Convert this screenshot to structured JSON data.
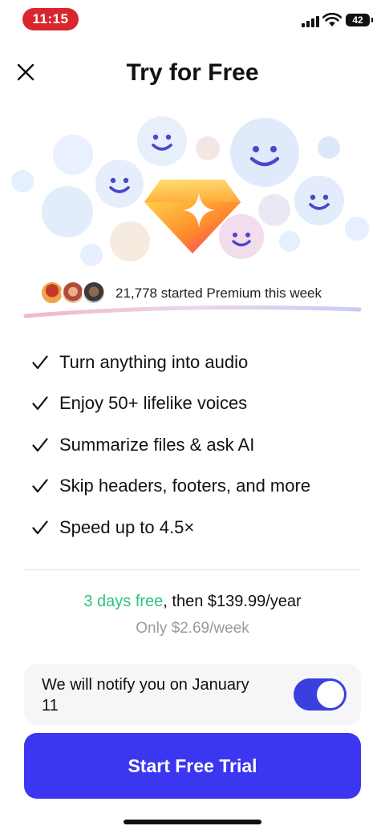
{
  "status_bar": {
    "time": "11:15",
    "battery": "42"
  },
  "header": {
    "title": "Try for Free",
    "close_icon": "close-icon"
  },
  "hero": {
    "center_icon": "diamond-sparkle-icon",
    "faces": [
      "smiley-face",
      "smiley-face",
      "smiley-face",
      "smiley-face",
      "smiley-face"
    ]
  },
  "social_proof": {
    "text": "21,778 started Premium this week"
  },
  "features": [
    {
      "label": "Turn anything into audio"
    },
    {
      "label": "Enjoy 50+ lifelike voices"
    },
    {
      "label": "Summarize files & ask AI"
    },
    {
      "label": "Skip headers, footers, and more"
    },
    {
      "label": "Speed up to 4.5×"
    }
  ],
  "pricing": {
    "free_text": "3 days free",
    "then_text": ", then $139.99/year",
    "weekly_text": "Only $2.69/week"
  },
  "notify": {
    "label": "We will notify you on January 11",
    "toggle_on": true
  },
  "cta": {
    "label": "Start Free Trial"
  },
  "colors": {
    "accent": "#3b36f0",
    "free_green": "#2ec27e",
    "time_pill": "#d9262e"
  }
}
